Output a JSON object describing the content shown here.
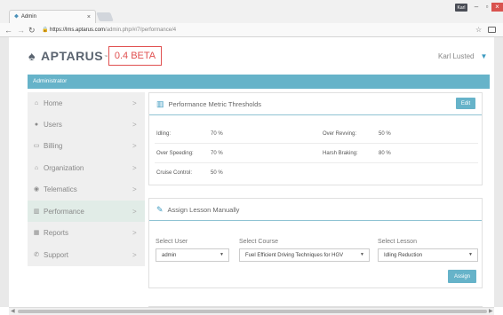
{
  "browser": {
    "tab_title": "Admin",
    "tab_close": "×",
    "url_host": "https://lms.aptarus.com",
    "url_path": "/admin.php/#/7/performance/4",
    "user_badge": "Karl"
  },
  "header": {
    "logo_text": "APTARUS",
    "logo_tm": "™",
    "beta_label": "0.4 BETA",
    "user_name": "Karl Lusted"
  },
  "admin_bar": {
    "label": "Administrator"
  },
  "sidebar": {
    "items": [
      {
        "label": "Home",
        "icon": "home-icon"
      },
      {
        "label": "Users",
        "icon": "user-icon"
      },
      {
        "label": "Billing",
        "icon": "credit-card-icon"
      },
      {
        "label": "Organization",
        "icon": "sitemap-icon"
      },
      {
        "label": "Telematics",
        "icon": "globe-icon"
      },
      {
        "label": "Performance",
        "icon": "bar-chart-icon",
        "active": true
      },
      {
        "label": "Reports",
        "icon": "calendar-icon"
      },
      {
        "label": "Support",
        "icon": "phone-icon"
      }
    ],
    "chevron": ">"
  },
  "thresholds": {
    "title": "Performance Metric Thresholds",
    "edit_label": "Edit",
    "metrics": [
      {
        "label": "Idling:",
        "value": "70 %"
      },
      {
        "label": "Over Revving:",
        "value": "50 %"
      },
      {
        "label": "Over Speeding:",
        "value": "70 %"
      },
      {
        "label": "Harsh Braking:",
        "value": "80 %"
      },
      {
        "label": "Cruise Control:",
        "value": "50 %"
      }
    ]
  },
  "assign": {
    "title": "Assign Lesson Manually",
    "select_user_label": "Select User",
    "select_user_value": "admin",
    "select_course_label": "Select Course",
    "select_course_value": "Fuel Efficient Driving Techniques for HGV",
    "select_lesson_label": "Select Lesson",
    "select_lesson_value": "Idling Reduction",
    "assign_label": "Assign"
  },
  "colors": {
    "accent": "#66b3c9",
    "beta": "#e05050",
    "sidebar_bg": "#efefef",
    "sidebar_active": "#e1ece7"
  }
}
